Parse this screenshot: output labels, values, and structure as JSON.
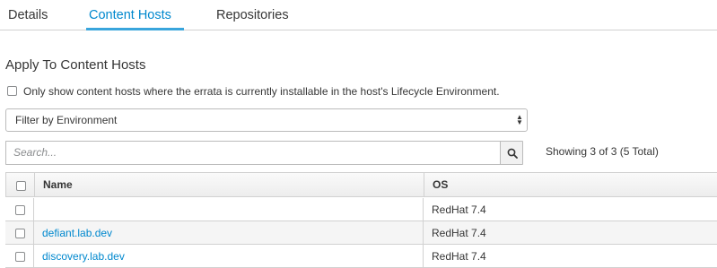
{
  "tabs": [
    {
      "label": "Details",
      "active": false
    },
    {
      "label": "Content Hosts",
      "active": true
    },
    {
      "label": "Repositories",
      "active": false
    }
  ],
  "section": {
    "title": "Apply To Content Hosts",
    "errata_checkbox_label": "Only show content hosts where the errata is currently installable in the host's Lifecycle Environment."
  },
  "filter": {
    "selected": "Filter by Environment"
  },
  "search": {
    "placeholder": "Search...",
    "icon": "search-icon"
  },
  "showing": "Showing 3 of 3 (5 Total)",
  "table": {
    "columns": [
      "Name",
      "OS"
    ],
    "rows": [
      {
        "name": "",
        "os": "RedHat 7.4"
      },
      {
        "name": "defiant.lab.dev",
        "os": "RedHat 7.4"
      },
      {
        "name": "discovery.lab.dev",
        "os": "RedHat 7.4"
      }
    ]
  },
  "colors": {
    "accent": "#0088ce",
    "tab_underline": "#39a5dc"
  }
}
